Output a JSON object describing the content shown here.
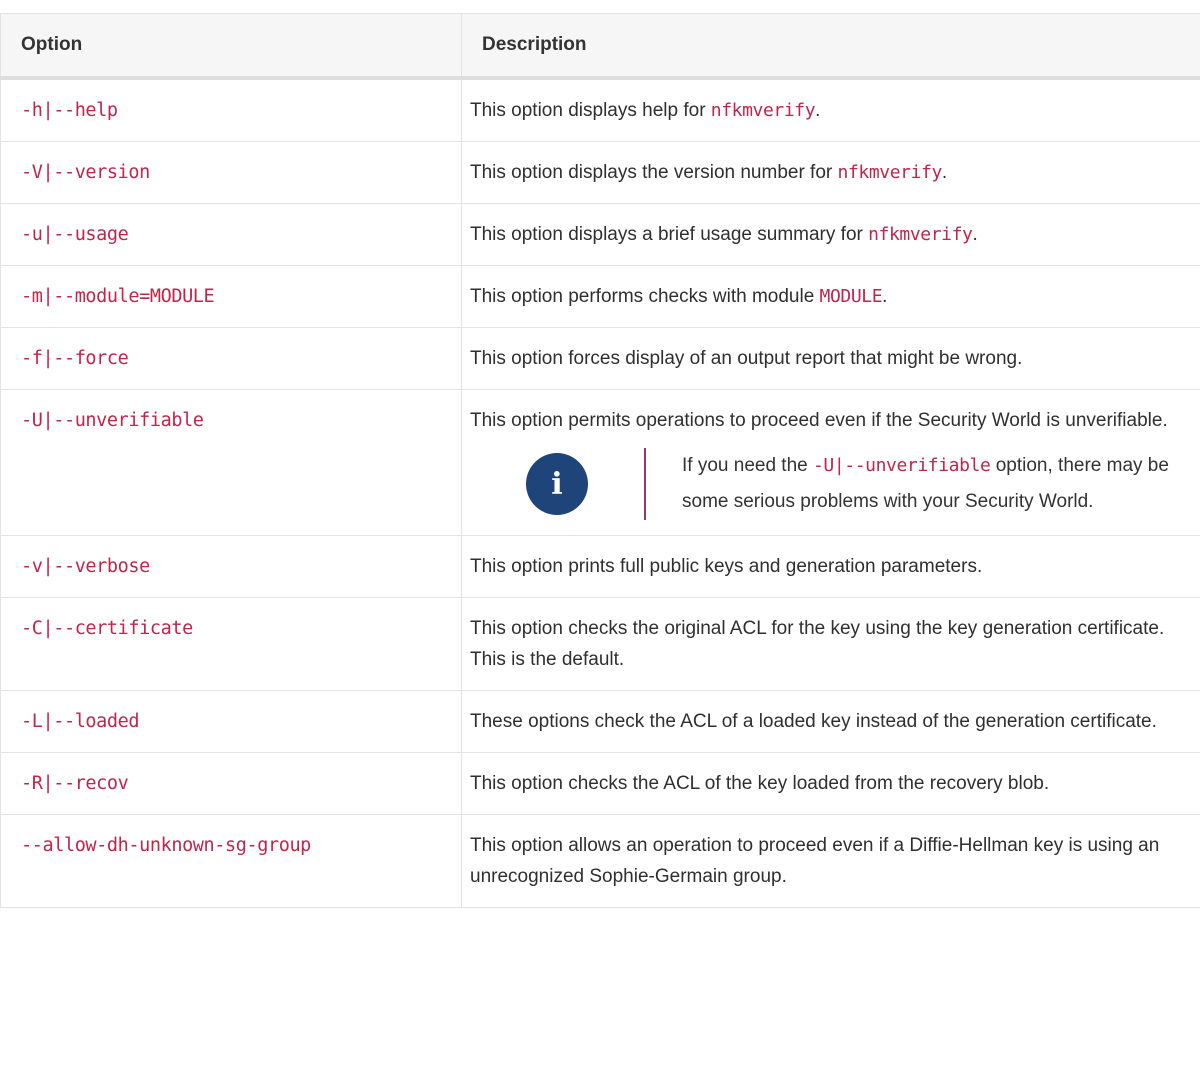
{
  "headers": {
    "option": "Option",
    "description": "Description"
  },
  "rows": [
    {
      "option": "-h|--help",
      "desc_pre": "This option displays help for ",
      "desc_code": "nfkmverify",
      "desc_post": "."
    },
    {
      "option": "-V|--version",
      "desc_pre": "This option displays the version number for ",
      "desc_code": "nfkmverify",
      "desc_post": "."
    },
    {
      "option": "-u|--usage",
      "desc_pre": "This option displays a brief usage summary for ",
      "desc_code": "nfkmverify",
      "desc_post": "."
    },
    {
      "option": "-m|--module=MODULE",
      "desc_pre": "This option performs checks with module ",
      "desc_code": "MODULE",
      "desc_post": "."
    },
    {
      "option": "-f|--force",
      "desc_pre": "This option forces display of an output report that might be wrong.",
      "desc_code": "",
      "desc_post": ""
    },
    {
      "option": "-U|--unverifiable",
      "desc_pre": "This option permits operations to proceed even if the Security World is unverifiable.",
      "desc_code": "",
      "desc_post": ""
    },
    {
      "option": "-v|--verbose",
      "desc_pre": "This option prints full public keys and generation parameters.",
      "desc_code": "",
      "desc_post": ""
    },
    {
      "option": "-C|--certificate",
      "desc_pre": "This option checks the original ACL for the key using the key generation certificate. This is the default.",
      "desc_code": "",
      "desc_post": ""
    },
    {
      "option": "-L|--loaded",
      "desc_pre": "These options check the ACL of a loaded key instead of the generation certificate.",
      "desc_code": "",
      "desc_post": ""
    },
    {
      "option": "-R|--recov",
      "desc_pre": "This option checks the ACL of the key loaded from the recovery blob.",
      "desc_code": "",
      "desc_post": ""
    },
    {
      "option": "--allow-dh-unknown-sg-group",
      "desc_pre": "This option allows an operation to proceed even if a Diffie-Hellman key is using an unrecognized Sophie-Germain group.",
      "desc_code": "",
      "desc_post": ""
    }
  ],
  "note": {
    "icon": "info-icon",
    "pre": "If you need the ",
    "code": "-U|--unverifiable",
    "post": " option, there may be some serious problems with your Security World."
  },
  "colors": {
    "code": "#c0254a",
    "note_icon_bg": "#1f4479",
    "note_bar": "#8a3c6f",
    "header_bg": "#f6f6f6"
  }
}
